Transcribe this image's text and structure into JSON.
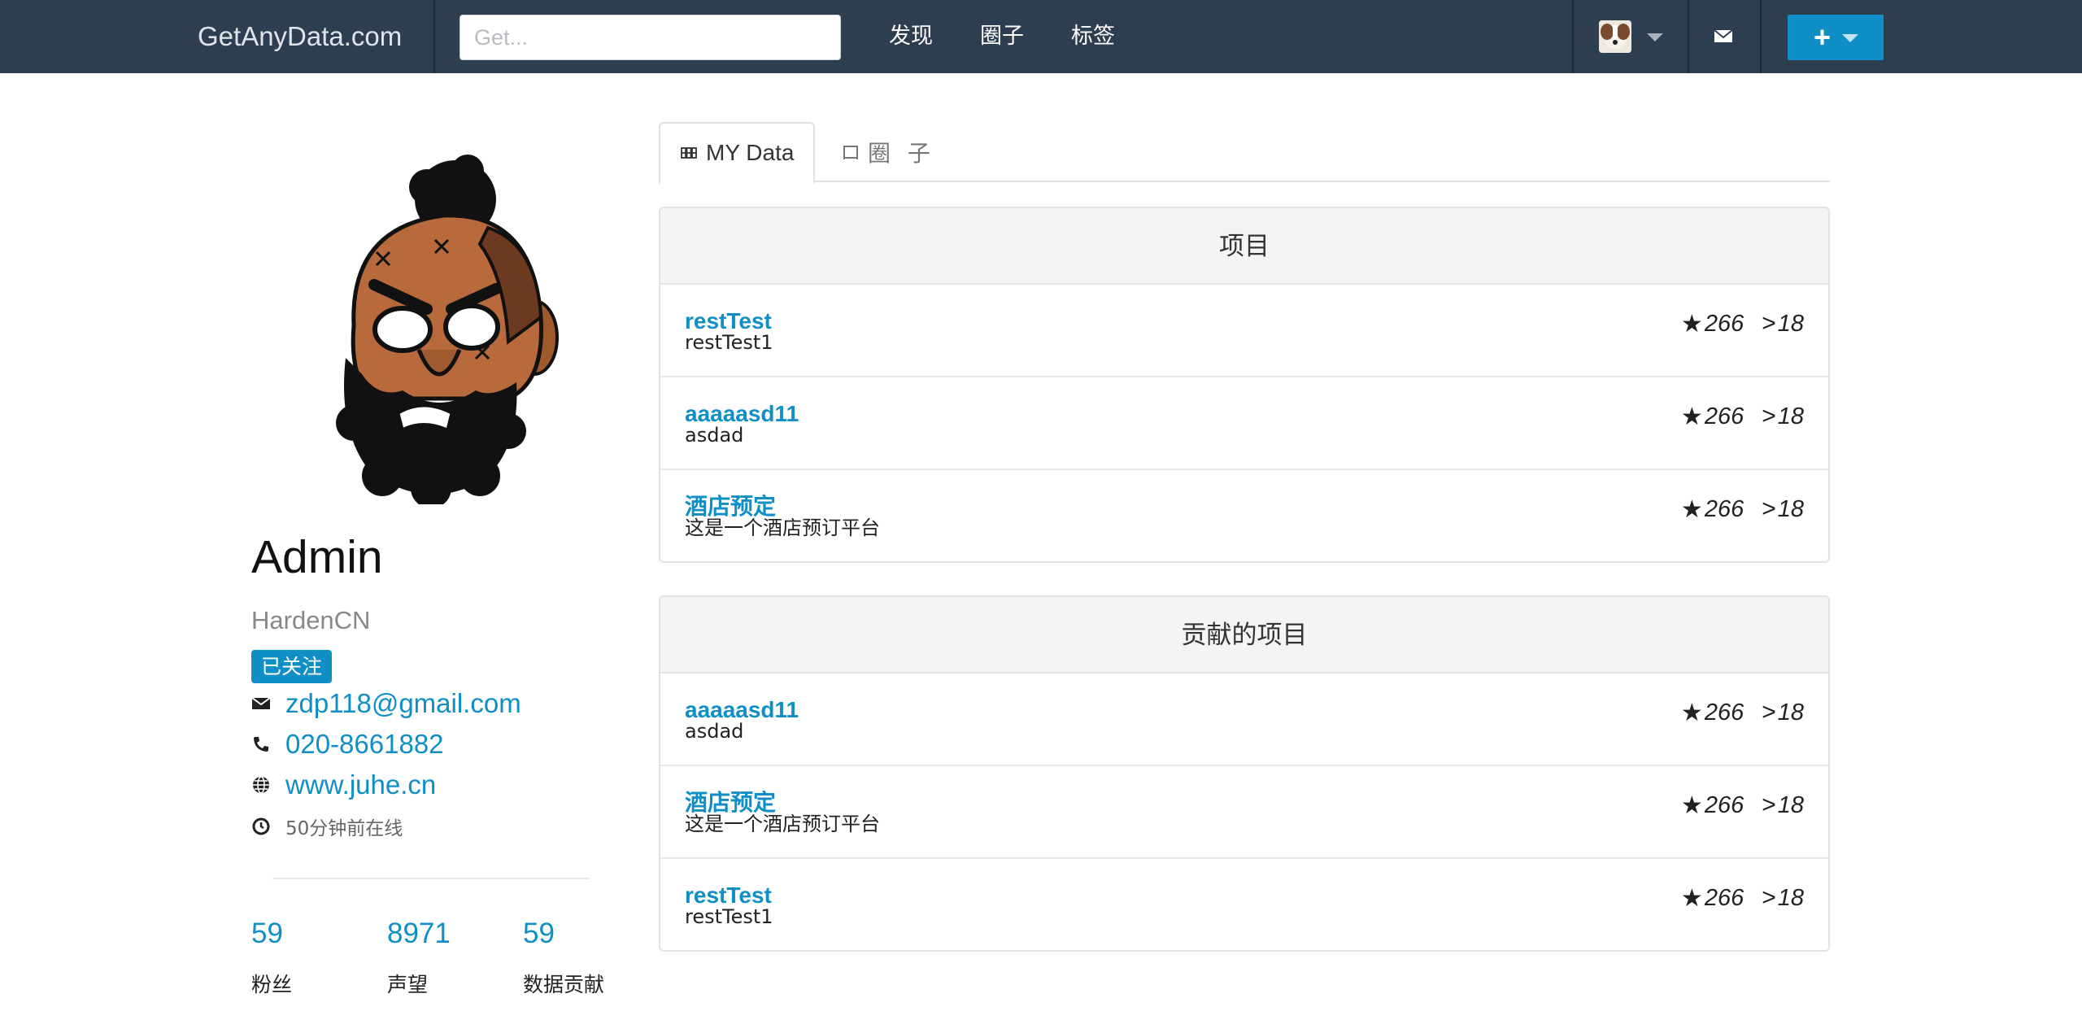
{
  "navbar": {
    "brand": "GetAnyData.com",
    "search_placeholder": "Get...",
    "links": [
      "发现",
      "圈子",
      "标签"
    ],
    "plus_glyph": "+",
    "icons": {
      "user_avatar": "user-avatar",
      "mail": "mail-icon",
      "create": "plus-icon"
    }
  },
  "profile": {
    "name": "Admin",
    "handle": "HardenCN",
    "follow_badge": "已关注",
    "email": "zdp118@gmail.com",
    "phone": "020-8661882",
    "website": "www.juhe.cn",
    "last_online": "50分钟前在线",
    "stats": [
      {
        "value": "59",
        "label": "粉丝"
      },
      {
        "value": "8971",
        "label": "声望"
      },
      {
        "value": "59",
        "label": "数据贡献"
      }
    ]
  },
  "tabs": [
    {
      "label": "MY Data",
      "icon": "grid-icon",
      "active": true
    },
    {
      "label": "圈 子",
      "icon": "circle-square-icon",
      "active": false
    }
  ],
  "panels": [
    {
      "title": "项目",
      "items": [
        {
          "name": "restTest",
          "desc": "restTest1",
          "stars": "266",
          "forks": "18"
        },
        {
          "name": "aaaaasd11",
          "desc": "asdad",
          "stars": "266",
          "forks": "18"
        },
        {
          "name": "酒店预定",
          "desc": "这是一个酒店预订平台",
          "stars": "266",
          "forks": "18"
        }
      ]
    },
    {
      "title": "贡献的项目",
      "items": [
        {
          "name": "aaaaasd11",
          "desc": "asdad",
          "stars": "266",
          "forks": "18"
        },
        {
          "name": "酒店预定",
          "desc": "这是一个酒店预订平台",
          "stars": "266",
          "forks": "18"
        },
        {
          "name": "restTest",
          "desc": "restTest1",
          "stars": "266",
          "forks": "18"
        }
      ]
    }
  ],
  "colors": {
    "navbar": "#2c3e50",
    "accent": "#0f8fc6"
  }
}
